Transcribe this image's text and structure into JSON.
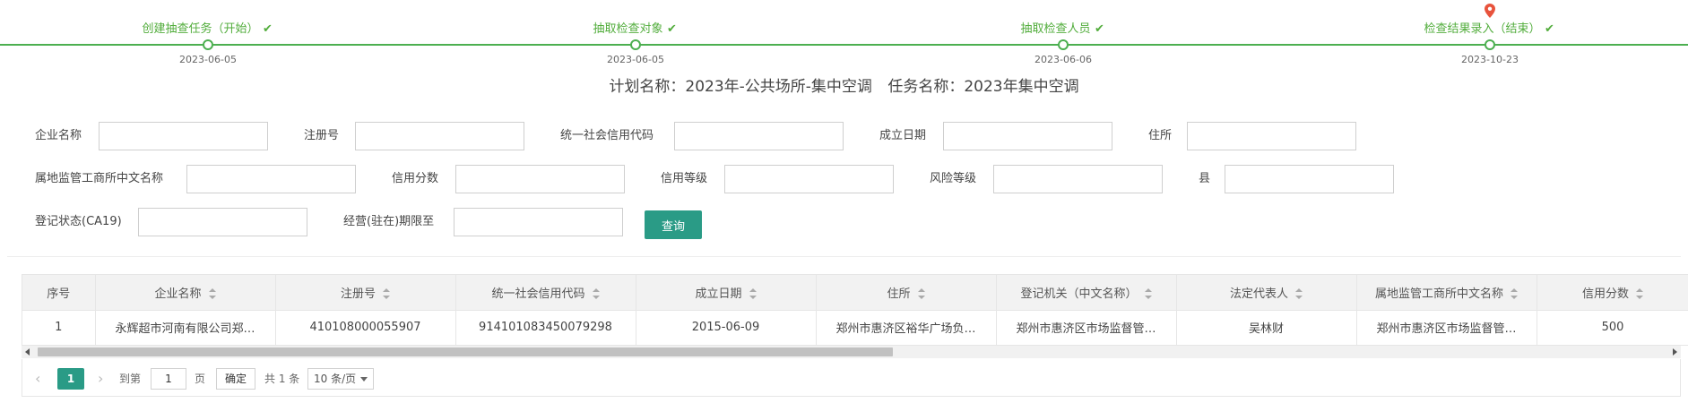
{
  "steps": [
    {
      "label": "创建抽查任务（开始）",
      "date": "2023-06-05",
      "done": true
    },
    {
      "label": "抽取检查对象",
      "date": "2023-06-05",
      "done": true
    },
    {
      "label": "抽取检查人员",
      "date": "2023-06-06",
      "done": true
    },
    {
      "label": "检查结果录入（结束）",
      "date": "2023-10-23",
      "done": true,
      "current": true
    }
  ],
  "plan": {
    "plan_name": "计划名称：2023年-公共场所-集中空调",
    "task_name": "任务名称：2023年集中空调"
  },
  "form": {
    "company_name": {
      "label": "企业名称",
      "value": ""
    },
    "reg_no": {
      "label": "注册号",
      "value": ""
    },
    "credit_code": {
      "label": "统一社会信用代码",
      "value": ""
    },
    "est_date": {
      "label": "成立日期",
      "value": ""
    },
    "address": {
      "label": "住所",
      "value": ""
    },
    "local_bureau": {
      "label": "属地监管工商所中文名称",
      "value": ""
    },
    "credit_score": {
      "label": "信用分数",
      "value": ""
    },
    "credit_level": {
      "label": "信用等级",
      "value": ""
    },
    "risk_level": {
      "label": "风险等级",
      "value": ""
    },
    "county": {
      "label": "县",
      "value": ""
    },
    "reg_status": {
      "label": "登记状态(CA19)",
      "value": ""
    },
    "term_until": {
      "label": "经营(驻在)期限至",
      "value": ""
    },
    "query_button": "查询"
  },
  "table": {
    "columns": [
      "序号",
      "企业名称",
      "注册号",
      "统一社会信用代码",
      "成立日期",
      "住所",
      "登记机关（中文名称）",
      "法定代表人",
      "属地监管工商所中文名称",
      "信用分数"
    ],
    "rows": [
      [
        "1",
        "永辉超市河南有限公司郑…",
        "410108000055907",
        "914101083450079298",
        "2015-06-09",
        "郑州市惠济区裕华广场负…",
        "郑州市惠济区市场监督管…",
        "吴林财",
        "郑州市惠济区市场监督管…",
        "500"
      ]
    ]
  },
  "pager": {
    "current_page": "1",
    "goto_label": "到第",
    "goto_value": "1",
    "page_unit": "页",
    "confirm": "确定",
    "total": "共 1 条",
    "page_size": "10 条/页"
  },
  "colors": {
    "accent": "#2a9b86",
    "step_green": "#52ad3c",
    "pin": "#e8533c"
  }
}
